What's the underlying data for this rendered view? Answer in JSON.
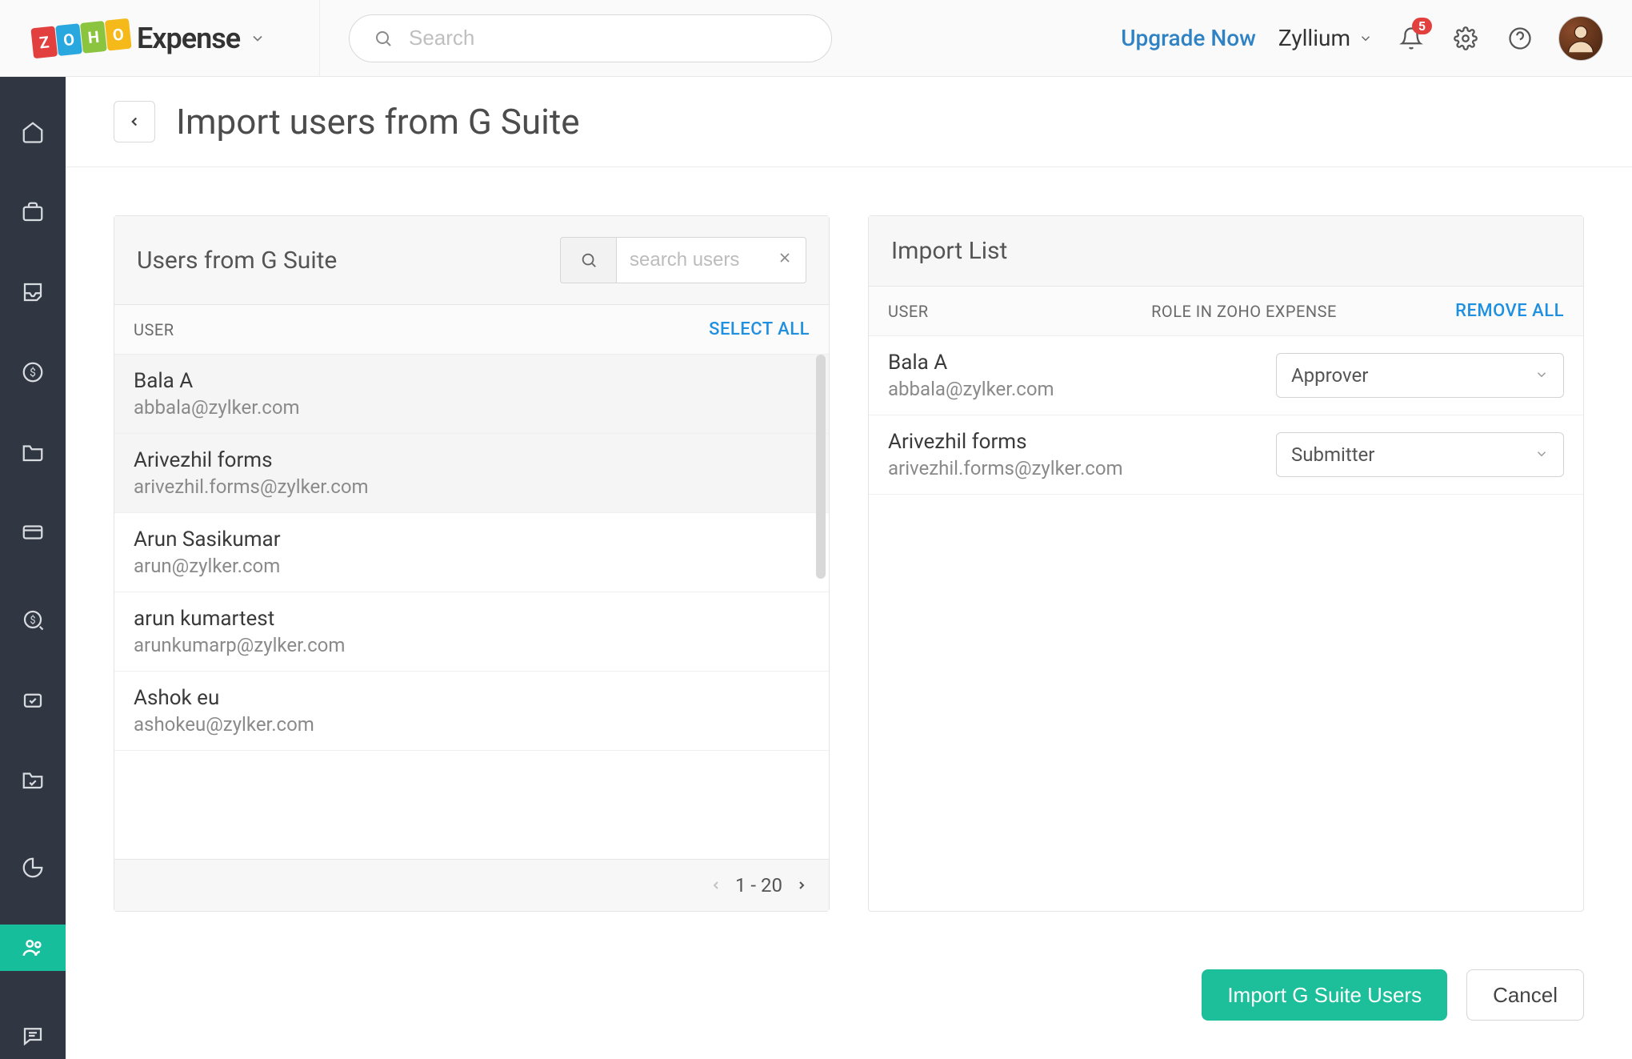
{
  "brand": {
    "name": "Expense",
    "tiles": [
      "Z",
      "O",
      "H",
      "O"
    ]
  },
  "topbar": {
    "search_placeholder": "Search",
    "upgrade": "Upgrade Now",
    "org": "Zyllium",
    "notif_count": "5"
  },
  "page": {
    "title": "Import users from G Suite"
  },
  "left_panel": {
    "title": "Users from G Suite",
    "search_placeholder": "search users",
    "col_user": "USER",
    "select_all": "SELECT ALL",
    "pagination": "1 - 20",
    "users": [
      {
        "name": "Bala A",
        "email": "abbala@zylker.com",
        "selected": true
      },
      {
        "name": "Arivezhil forms",
        "email": "arivezhil.forms@zylker.com",
        "selected": true
      },
      {
        "name": "Arun Sasikumar",
        "email": "arun@zylker.com",
        "selected": false
      },
      {
        "name": "arun kumartest",
        "email": "arunkumarp@zylker.com",
        "selected": false
      },
      {
        "name": "Ashok eu",
        "email": "ashokeu@zylker.com",
        "selected": false
      }
    ]
  },
  "right_panel": {
    "title": "Import List",
    "col_user": "USER",
    "col_role": "ROLE IN ZOHO EXPENSE",
    "remove_all": "REMOVE ALL",
    "users": [
      {
        "name": "Bala A",
        "email": "abbala@zylker.com",
        "role": "Approver"
      },
      {
        "name": "Arivezhil forms",
        "email": "arivezhil.forms@zylker.com",
        "role": "Submitter"
      }
    ]
  },
  "actions": {
    "primary": "Import G Suite Users",
    "cancel": "Cancel"
  }
}
